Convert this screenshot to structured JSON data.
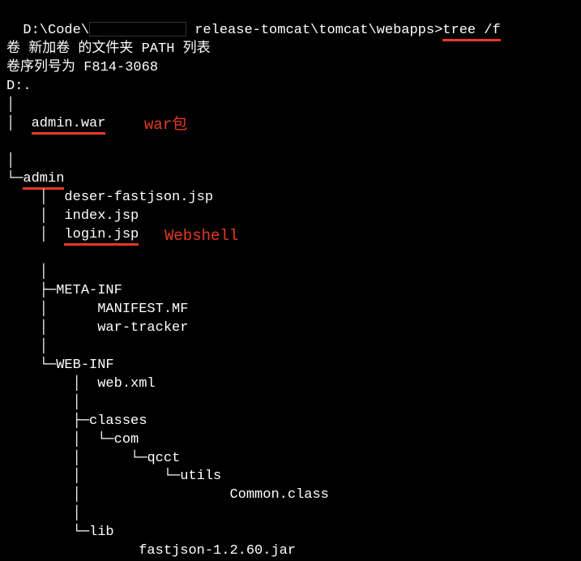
{
  "prompt": {
    "path_prefix": "D:\\Code\\",
    "path_suffix": " release-tomcat\\tomcat\\webapps>",
    "command": "tree /f"
  },
  "header": {
    "line1": "卷 新加卷 的文件夹 PATH 列表",
    "line2": "卷序列号为 F814-3068",
    "line3": "D:."
  },
  "tree": {
    "admin_war": "admin.war",
    "admin_dir": "admin",
    "admin_files": {
      "f1": "deser-fastjson.jsp",
      "f2": "index.jsp",
      "f3": "login.jsp"
    },
    "meta_inf": {
      "name": "META-INF",
      "f1": "MANIFEST.MF",
      "f2": "war-tracker"
    },
    "web_inf": {
      "name": "WEB-INF",
      "web_xml": "web.xml",
      "classes": "classes",
      "com": "com",
      "qcct": "qcct",
      "utils": "utils",
      "common_class": "Common.class",
      "lib": "lib",
      "fastjson": "fastjson-1.2.60.jar"
    }
  },
  "annotations": {
    "war_label": "war包",
    "webshell_label": "Webshell"
  }
}
